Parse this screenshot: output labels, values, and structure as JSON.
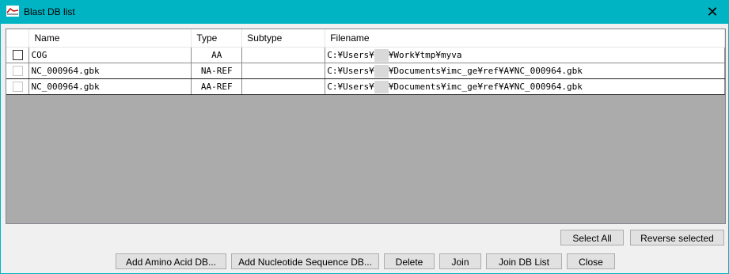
{
  "window": {
    "title": "Blast DB list"
  },
  "table": {
    "columns": [
      "Name",
      "Type",
      "Subtype",
      "Filename"
    ],
    "rows": [
      {
        "checked": false,
        "name": "COG",
        "type": "AA",
        "subtype": "",
        "filename_prefix": "C:¥Users¥",
        "filename_suffix": "¥Work¥tmp¥myva"
      },
      {
        "checked": false,
        "name": "NC_000964.gbk",
        "type": "NA-REF",
        "subtype": "",
        "filename_prefix": "C:¥Users¥",
        "filename_suffix": "¥Documents¥imc_ge¥ref¥A¥NC_000964.gbk"
      },
      {
        "checked": false,
        "name": "NC_000964.gbk",
        "type": "AA-REF",
        "subtype": "",
        "filename_prefix": "C:¥Users¥",
        "filename_suffix": "¥Documents¥imc_ge¥ref¥A¥NC_000964.gbk"
      }
    ]
  },
  "buttons": {
    "select_all": "Select All",
    "reverse_selected": "Reverse selected",
    "add_amino": "Add Amino Acid DB...",
    "add_nucleotide": "Add Nucleotide Sequence DB...",
    "delete": "Delete",
    "join": "Join",
    "join_db_list": "Join DB List",
    "close": "Close"
  }
}
